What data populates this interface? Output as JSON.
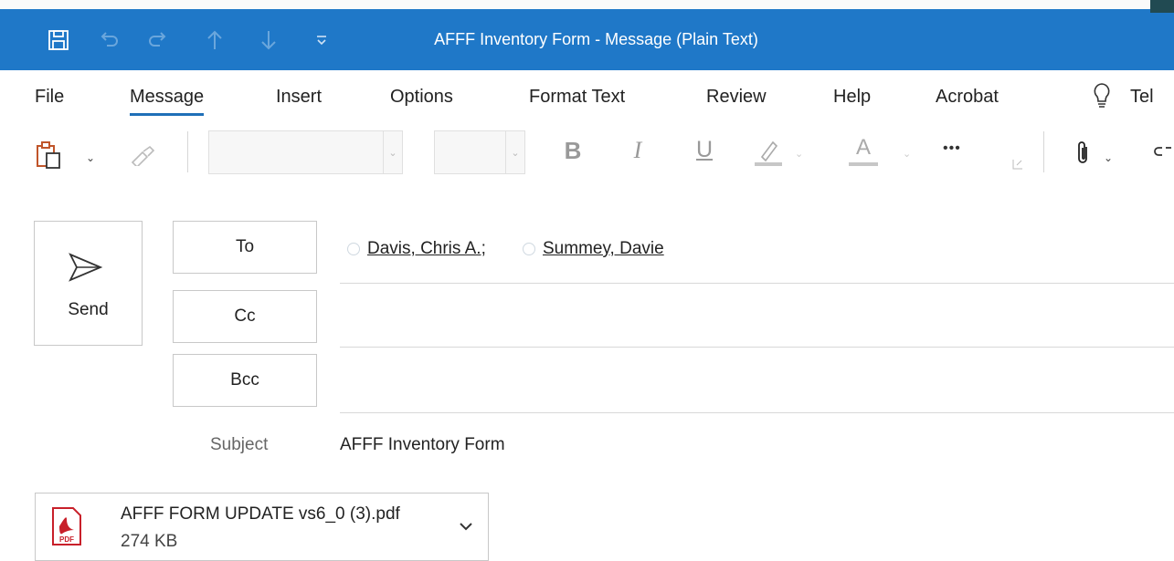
{
  "window": {
    "title": "AFFF Inventory Form  -  Message (Plain Text)",
    "accent": "#1f78c8"
  },
  "quick_access": {
    "icons": [
      "save-icon",
      "undo-icon",
      "redo-icon",
      "up-arrow-icon",
      "down-arrow-icon",
      "customize-dropdown-icon"
    ]
  },
  "menu": {
    "items": [
      {
        "label": "File"
      },
      {
        "label": "Message",
        "active": true
      },
      {
        "label": "Insert"
      },
      {
        "label": "Options"
      },
      {
        "label": "Format Text"
      },
      {
        "label": "Review"
      },
      {
        "label": "Help"
      },
      {
        "label": "Acrobat"
      },
      {
        "label": "Tel"
      }
    ]
  },
  "toolbar": {
    "bold": "B",
    "italic": "I",
    "underline": "U",
    "font_color": "A",
    "more": "•••",
    "font_name": "",
    "font_size": ""
  },
  "compose": {
    "send_label": "Send",
    "to_label": "To",
    "cc_label": "Cc",
    "bcc_label": "Bcc",
    "recipients": [
      "Davis, Chris A.;",
      "Summey, Davie"
    ],
    "cc_value": "",
    "bcc_value": "",
    "subject_label": "Subject",
    "subject_value": "AFFF Inventory Form"
  },
  "attachment": {
    "name": "AFFF FORM UPDATE vs6_0 (3).pdf",
    "size": "274 KB",
    "icon_label": "PDF"
  }
}
